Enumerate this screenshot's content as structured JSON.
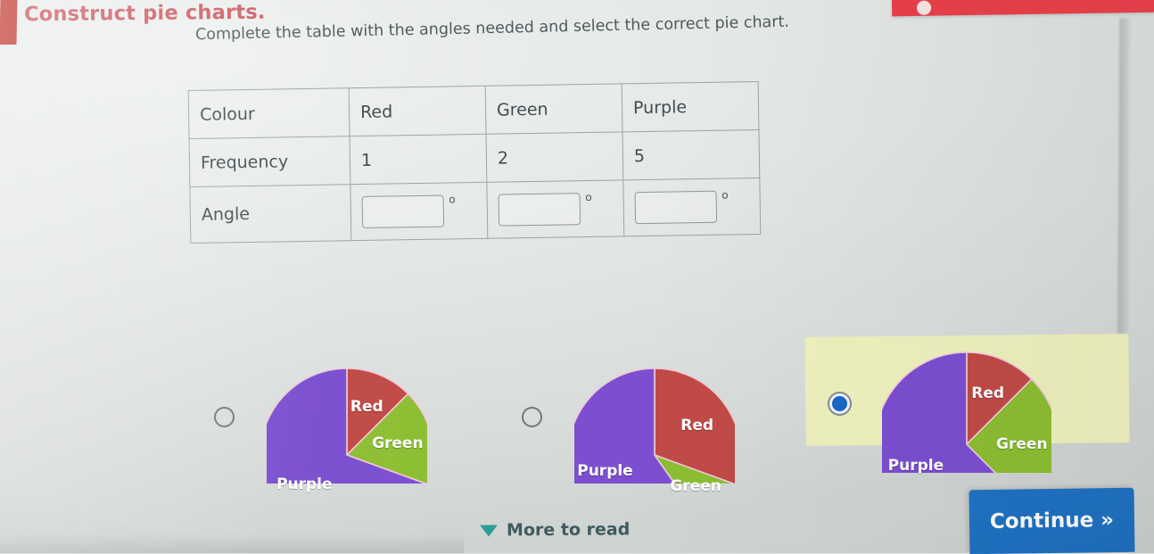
{
  "header": {
    "title": "Construct pie charts.",
    "subtitle": "Complete the table with the angles needed and select the correct pie chart."
  },
  "table": {
    "rows": [
      {
        "label": "Colour",
        "values": [
          "Red",
          "Green",
          "Purple"
        ]
      },
      {
        "label": "Frequency",
        "values": [
          "1",
          "2",
          "5"
        ]
      },
      {
        "label": "Angle",
        "values": [
          "",
          "",
          ""
        ]
      }
    ],
    "degree_symbol": "o",
    "angle_input_value": "",
    "angle_input_placeholder": ""
  },
  "options": [
    {
      "id": "option-1",
      "selected": false,
      "labels": {
        "red": "Red",
        "green": "Green",
        "purple": "Purple"
      }
    },
    {
      "id": "option-2",
      "selected": false,
      "labels": {
        "red": "Red",
        "green": "Green",
        "purple": "Purple"
      }
    },
    {
      "id": "option-3",
      "selected": true,
      "labels": {
        "red": "Red",
        "green": "Green",
        "purple": "Purple"
      }
    }
  ],
  "footer": {
    "more_to_read_label": "More to read",
    "more_to_read_icon": "caret-down-icon",
    "continue_label": "Continue »"
  },
  "colors": {
    "red": "#c04a46",
    "green": "#8cbe32",
    "purple": "#7b4fd0",
    "slice_divider": "#f2c9d8",
    "highlight": "#eef0bd",
    "accent_blue": "#1f72c4",
    "title_red": "#cc5a62",
    "teal": "#2e9c96",
    "banner_red": "#e8404a"
  },
  "chart_data": [
    {
      "type": "pie",
      "title": "Pie chart option 1",
      "categories": [
        "Red",
        "Green",
        "Purple"
      ],
      "values": [
        45,
        65,
        250
      ],
      "unit": "degrees",
      "start_angle": 0,
      "labels_shown": [
        "Red",
        "Green",
        "Purple"
      ],
      "colors": [
        "#c04a46",
        "#8cbe32",
        "#7b4fd0"
      ],
      "legend": "in-slice"
    },
    {
      "type": "pie",
      "title": "Pie chart option 2",
      "categories": [
        "Red",
        "Green",
        "Purple"
      ],
      "values": [
        110,
        35,
        215
      ],
      "unit": "degrees",
      "start_angle": 0,
      "labels_shown": [
        "Red",
        "Green",
        "Purple"
      ],
      "colors": [
        "#c04a46",
        "#8cbe32",
        "#7b4fd0"
      ],
      "legend": "in-slice"
    },
    {
      "type": "pie",
      "title": "Pie chart option 3",
      "categories": [
        "Red",
        "Green",
        "Purple"
      ],
      "values": [
        45,
        90,
        225
      ],
      "unit": "degrees",
      "start_angle": 0,
      "labels_shown": [
        "Red",
        "Green",
        "Purple"
      ],
      "colors": [
        "#c04a46",
        "#8cbe32",
        "#7b4fd0"
      ],
      "legend": "in-slice"
    }
  ]
}
